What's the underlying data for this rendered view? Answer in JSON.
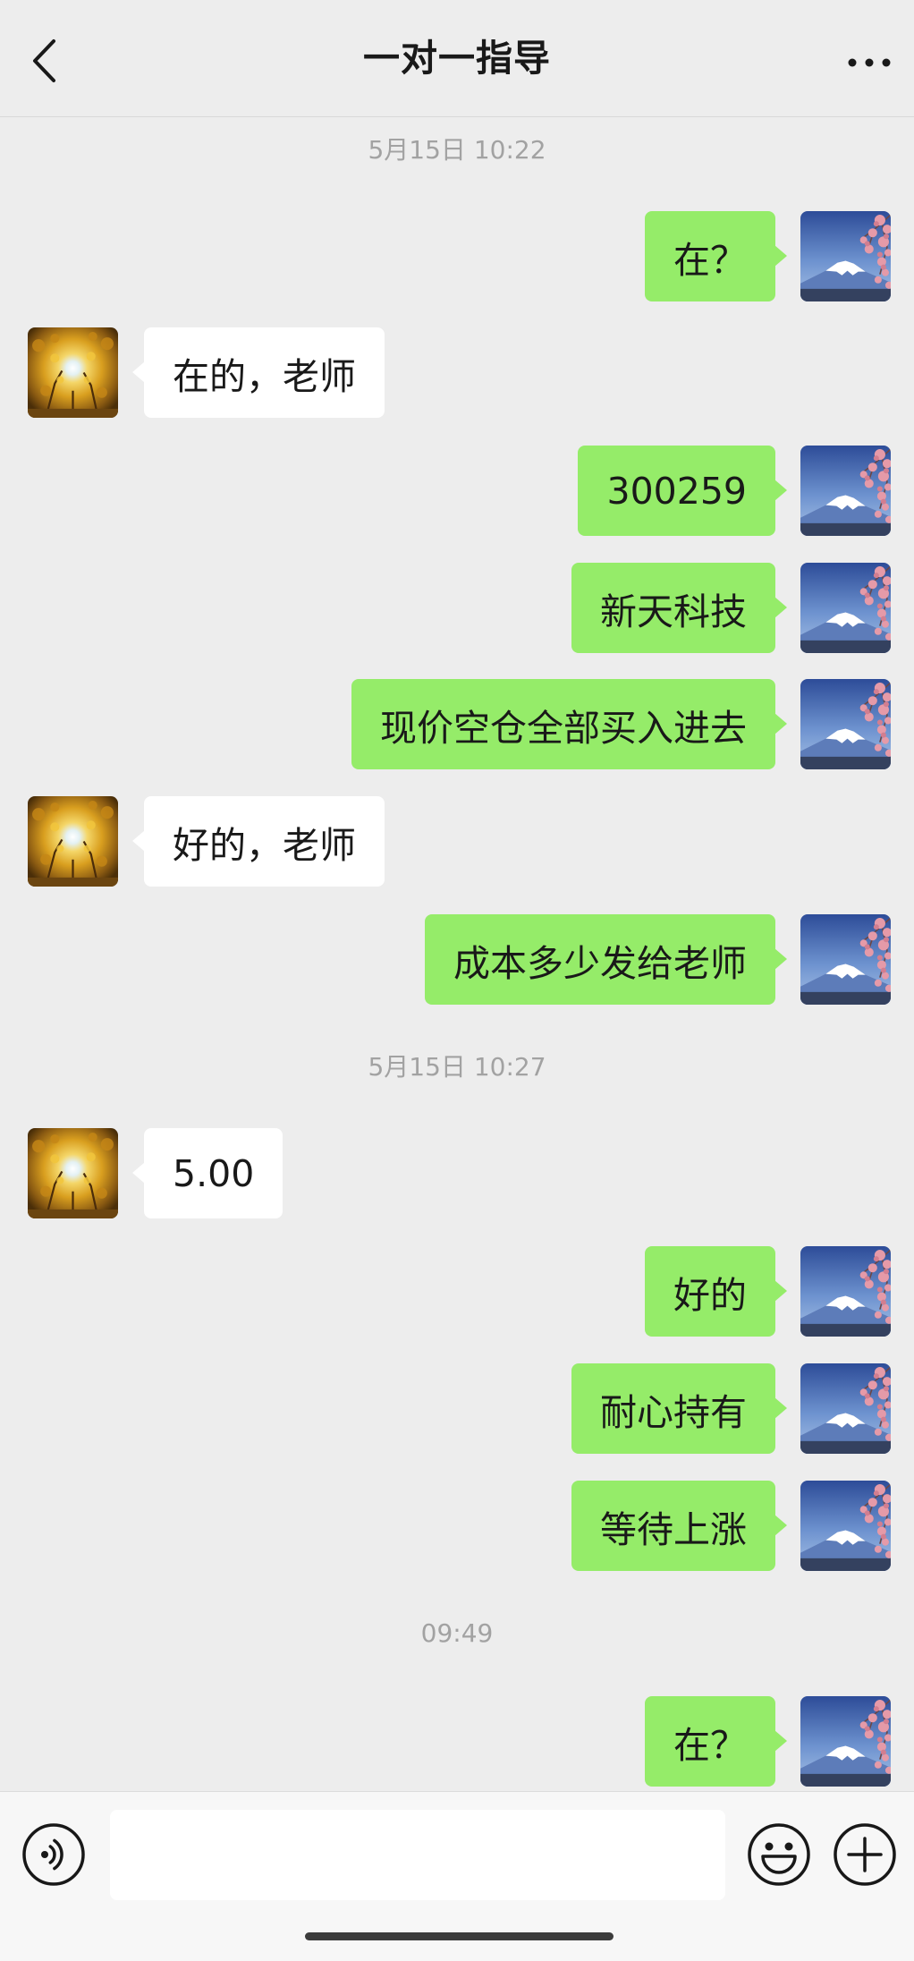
{
  "header": {
    "title": "一对一指导",
    "back_icon": "chevron-left-icon",
    "more_icon": "more-dots-icon"
  },
  "chat": {
    "items": [
      {
        "time": "5月15日 10:22"
      },
      {
        "sent": "在？"
      },
      {
        "received": "在的，老师"
      },
      {
        "sent": "300259"
      },
      {
        "sent": "新天科技"
      },
      {
        "sent": "现价空仓全部买入进去"
      },
      {
        "received": "好的，老师"
      },
      {
        "sent": "成本多少发给老师"
      },
      {
        "time": "5月15日 10:27"
      },
      {
        "received": "5.00"
      },
      {
        "sent": "好的"
      },
      {
        "sent": "耐心持有"
      },
      {
        "sent": "等待上涨"
      },
      {
        "time": "09:49"
      },
      {
        "sent": "在？"
      }
    ]
  },
  "input_bar": {
    "voice_icon": "voice-icon",
    "emoji_icon": "emoji-icon",
    "plus_icon": "plus-icon"
  },
  "colors": {
    "background": "#ededed",
    "sent_bubble": "#95ec69",
    "received_bubble": "#ffffff",
    "input_bar": "#f7f7f7"
  }
}
